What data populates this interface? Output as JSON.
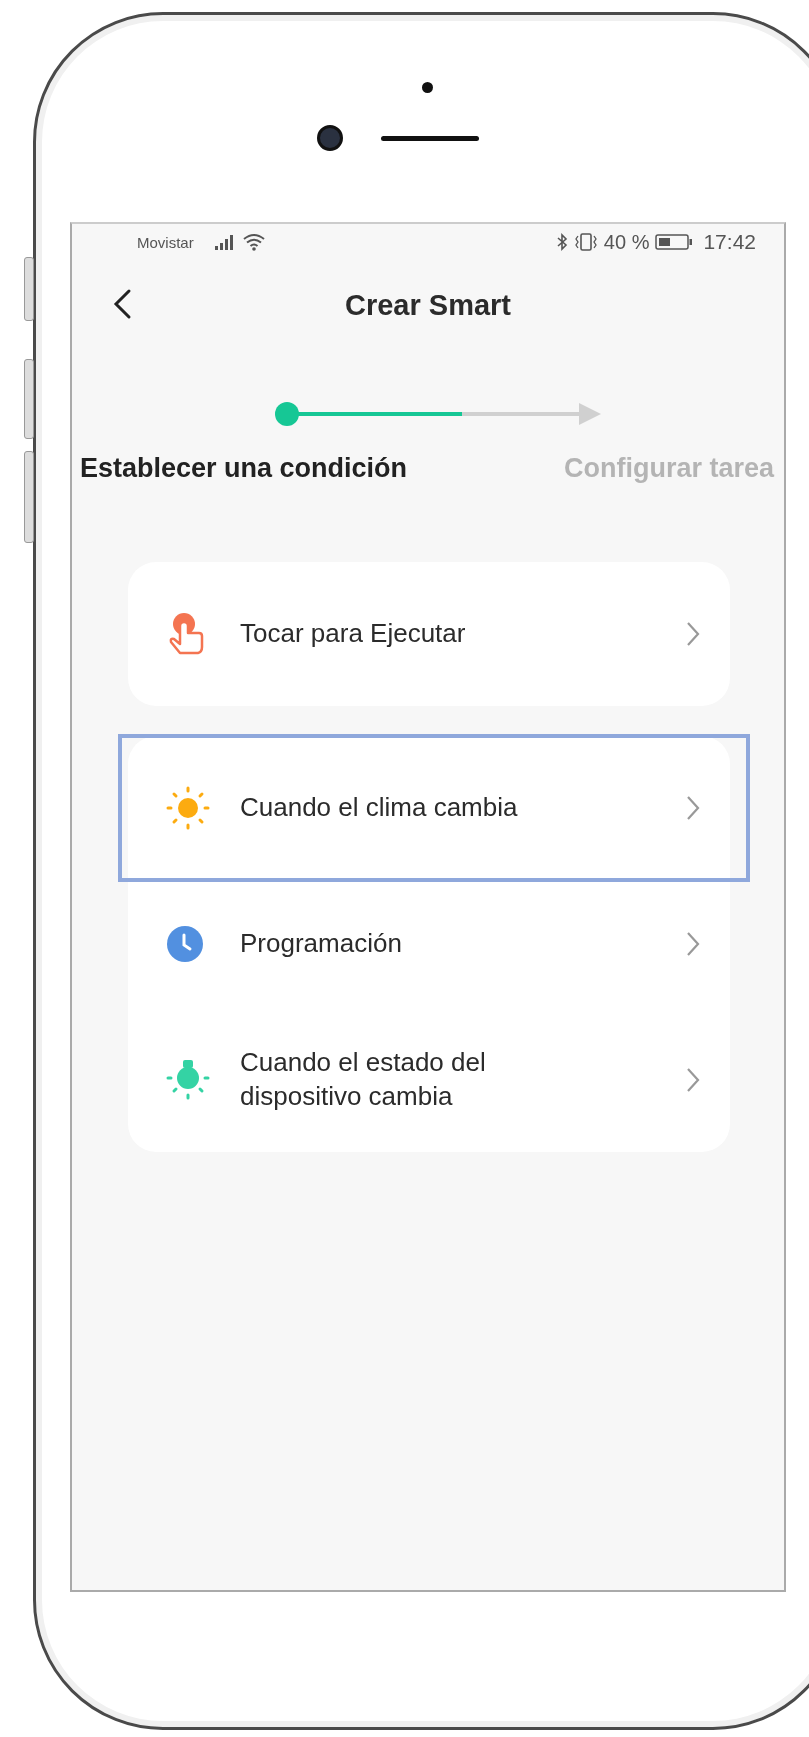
{
  "status_bar": {
    "carrier": "Movistar",
    "battery": "40 %",
    "time": "17:42"
  },
  "header": {
    "back": true,
    "title": "Crear Smart"
  },
  "steps": [
    {
      "label": "Establecer una condición",
      "selected": true
    },
    {
      "label": "Configurar tarea",
      "selected": false
    }
  ],
  "groups": [
    {
      "items": [
        {
          "kind": "touch",
          "label": "Tocar para Ejecutar",
          "highlighted": false
        }
      ]
    },
    {
      "items": [
        {
          "kind": "weather",
          "label": "Cuando el clima cambia",
          "highlighted": true
        },
        {
          "kind": "schedule",
          "label": "Programación",
          "highlighted": false
        },
        {
          "kind": "device",
          "label": "Cuando el estado del dispositivo cambia",
          "highlighted": false
        }
      ]
    }
  ]
}
